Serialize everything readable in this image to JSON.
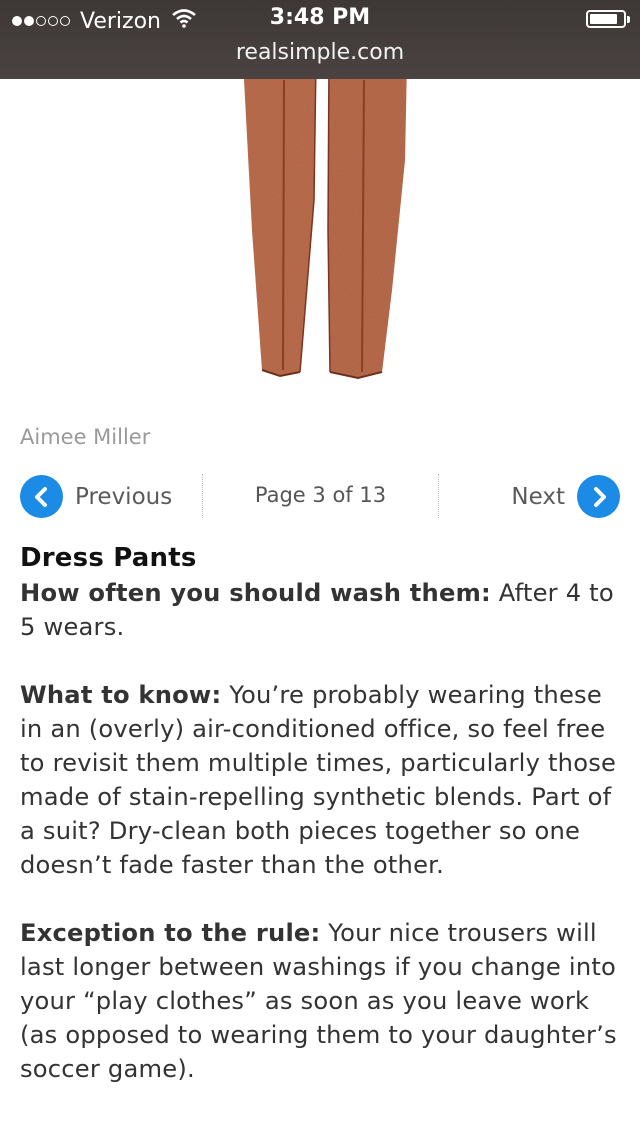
{
  "status_bar": {
    "carrier": "Verizon",
    "signal_bars_filled": 2,
    "signal_bars_total": 5,
    "time": "3:48 PM",
    "battery_level": 0.85,
    "url": "realsimple.com"
  },
  "image": {
    "description_icon": "dress-pants-illustration",
    "color": "#b25f3e",
    "credit": "Aimee Miller"
  },
  "pager": {
    "previous_label": "Previous",
    "next_label": "Next",
    "page_text": "Page 3 of 13",
    "accent": "#1b8be5"
  },
  "article": {
    "title": "Dress Pants",
    "frequency_label": "How often you should wash them:",
    "frequency_text": " After 4 to 5 wears.",
    "know_label": "What to know:",
    "know_text": " You’re probably wearing these in an (overly) air-conditioned office, so feel free to revisit them multiple times, particularly those made of stain-repelling synthetic blends. Part of a suit? Dry-clean both pieces together so one doesn’t fade faster than the other.",
    "exception_label": "Exception to the rule:",
    "exception_text": " Your nice trousers will last longer between washings if you change into your “play clothes” as soon as you leave work (as opposed to wearing them to your daughter’s soccer game)."
  }
}
